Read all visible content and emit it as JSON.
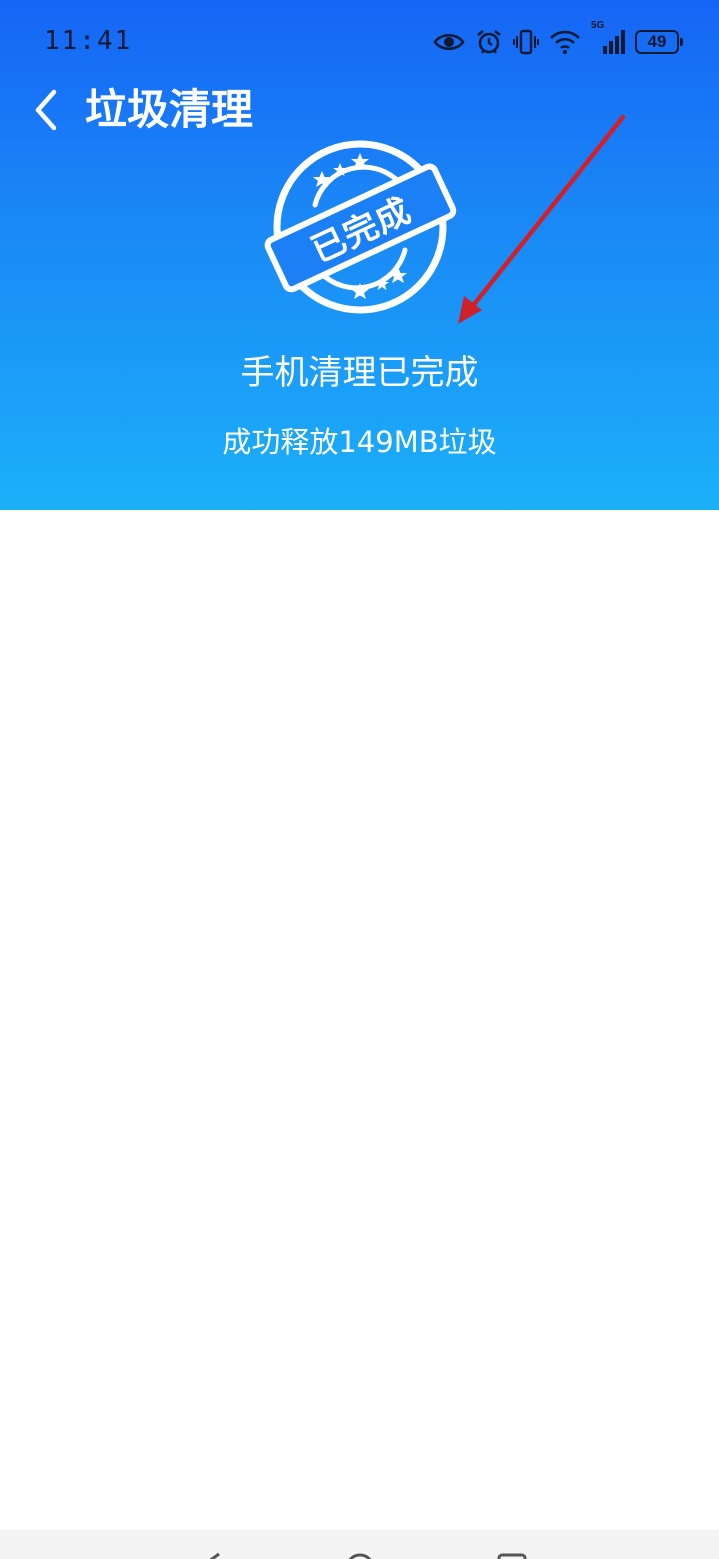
{
  "status_bar": {
    "time": "11:41",
    "network_label": "5G",
    "battery_level": "49",
    "icons": [
      "eye-icon",
      "alarm-icon",
      "vibrate-icon",
      "wifi-icon",
      "signal-icon",
      "battery-icon"
    ]
  },
  "nav": {
    "back_icon": "chevron-left-icon",
    "title": "垃圾清理"
  },
  "result": {
    "stamp_text": "已完成",
    "title": "手机清理已完成",
    "subtitle": "成功释放149MB垃圾"
  },
  "system_nav": {
    "icons": [
      "back-triangle-icon",
      "home-circle-icon",
      "recents-square-icon"
    ]
  },
  "colors": {
    "header_top": "#1565f5",
    "header_bottom": "#1bb0f9",
    "annotation_arrow": "#d0202a",
    "status_text": "#101a33"
  }
}
